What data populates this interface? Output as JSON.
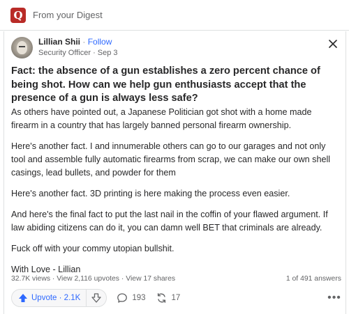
{
  "digest": {
    "title": "From your Digest",
    "logo_letter": "Q"
  },
  "author": {
    "name": "Lillian Shii",
    "separator": "·",
    "follow": "Follow",
    "credential": "Security Officer",
    "date": "Sep 3"
  },
  "close_icon": "×",
  "question": "Fact: the absence of a gun establishes a zero percent chance of being shot. How can we help gun enthusiasts accept that the presence of a gun is always less safe?",
  "answer_paragraphs": [
    "As others have pointed out, a Japanese Politician got shot with a home made firearm in a country that has largely banned personal firearm ownership.",
    "Here's another fact. I and innumerable others can go to our garages and not only tool and assemble fully automatic firearms from scrap, we can make our own shell casings, lead bullets, and powder for them",
    "Here's another fact. 3D printing is here making the process even easier.",
    "And here's the final fact to put the last nail in the coffin of your flawed argument. If law abiding citizens can do it, you can damn well BET that criminals are already.",
    "Fuck off with your commy utopian bullshit.",
    "With Love - Lillian"
  ],
  "stats": {
    "views": "32.7K views",
    "upvotes_link": "View 2,116 upvotes",
    "shares_link": "View 17 shares",
    "sep": " · ",
    "answer_position": "1 of 491 answers"
  },
  "actions": {
    "upvote_label": "Upvote",
    "upvote_count": "2.1K",
    "comments": "193",
    "shares": "17",
    "more": "•••"
  },
  "colors": {
    "brand": "#b92b27",
    "accent": "#2e69ff",
    "muted": "#636466"
  }
}
